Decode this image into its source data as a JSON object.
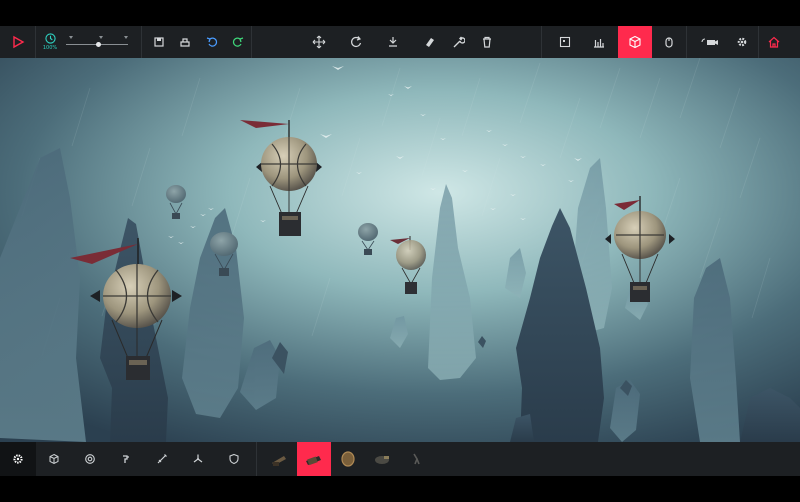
{
  "toolbar": {
    "speed_label": "100%",
    "tools_left": [
      "save-icon",
      "load-machine-icon",
      "undo-icon",
      "redo-icon"
    ],
    "tools_center": [
      "move-icon",
      "rotate-icon",
      "snap-down-icon",
      "eraser-icon",
      "wrench-icon",
      "trash-icon"
    ],
    "tools_right": [
      "frame-icon",
      "stats-icon",
      "cube-icon",
      "mouse-icon",
      "camera-icon",
      "settings-icon",
      "home-icon"
    ],
    "active_right": "cube-icon",
    "accent": "#ff2a4d",
    "speed_color": "#2ed3c2"
  },
  "bottombar": {
    "categories": [
      "gear-icon",
      "block-icon",
      "wheel-icon",
      "mechanism-icon",
      "weapon-icon",
      "flight-icon",
      "armour-icon"
    ],
    "blocks": [
      "cannon-block",
      "shrapnel-cannon-block",
      "shield-block",
      "bomb-block",
      "grabber-block"
    ],
    "active_block": "shrapnel-cannon-block"
  }
}
